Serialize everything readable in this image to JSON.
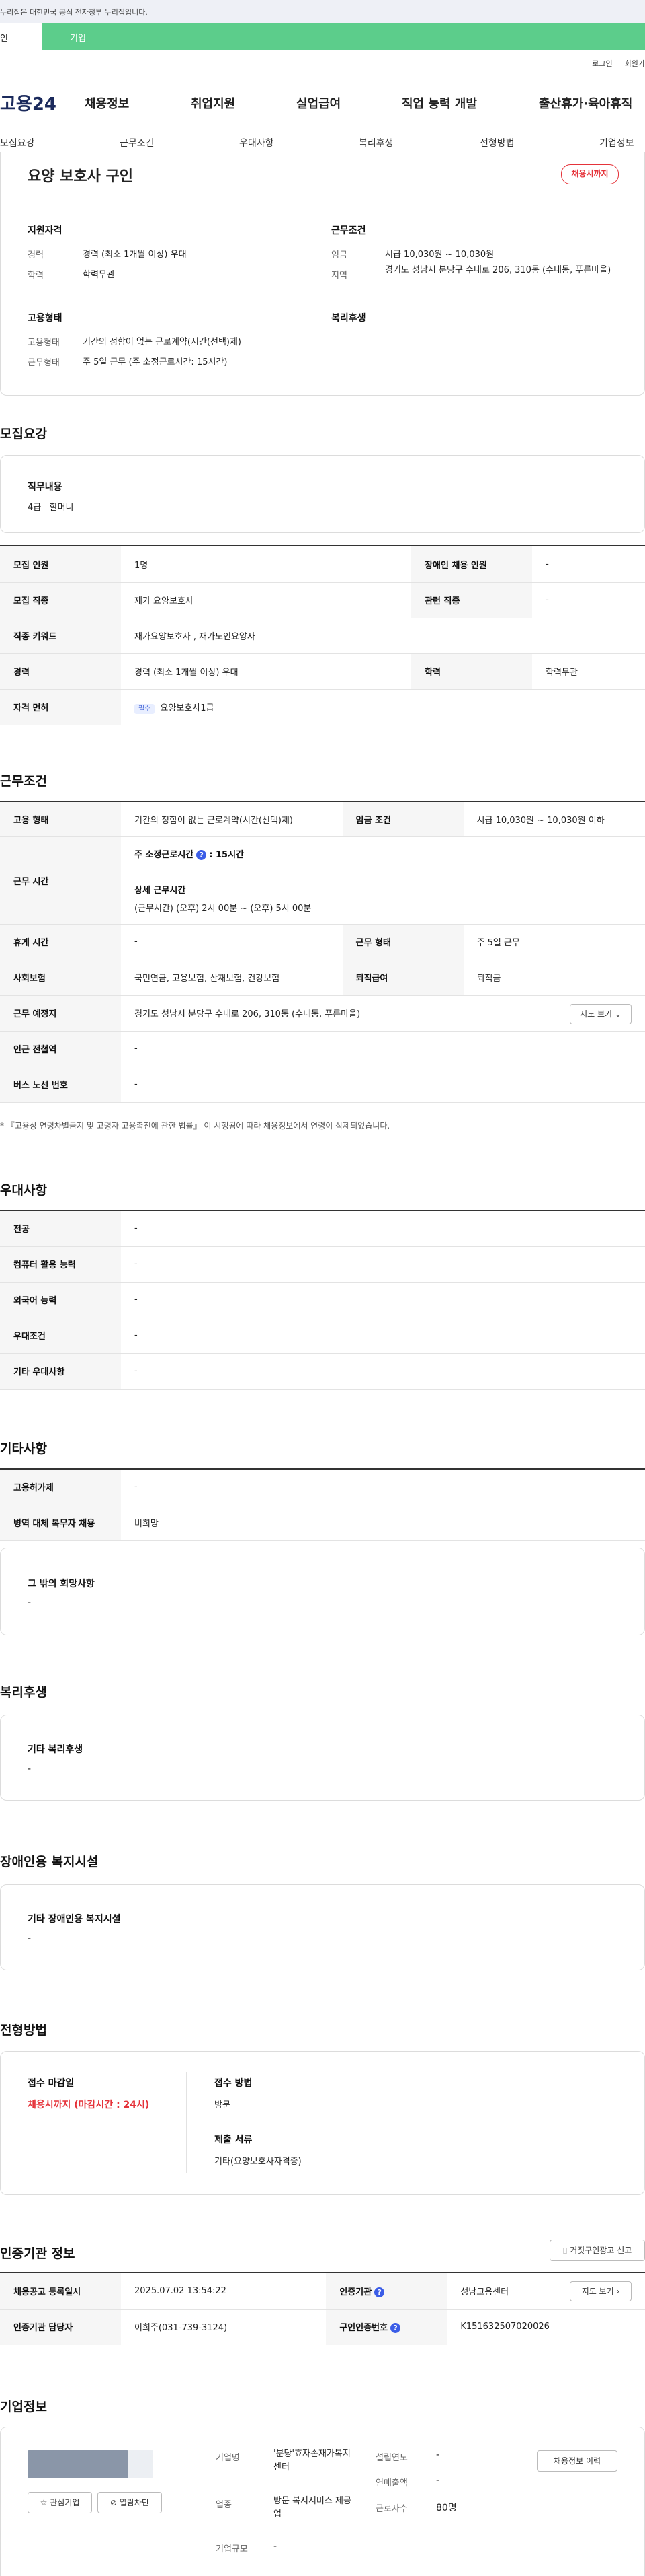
{
  "gov_banner": "누리집은 대한민국 공식 전자정부 누리집입니다.",
  "tabs": {
    "personal": "인",
    "company": "기업"
  },
  "util": {
    "login": "로그인",
    "join": "회원가"
  },
  "logo": "고용24",
  "gnb": [
    "채용정보",
    "취업지원",
    "실업급여",
    "직업 능력 개발",
    "출산휴가·육아휴직"
  ],
  "snb": [
    "모집요강",
    "근무조건",
    "우대사항",
    "복리후생",
    "전형방법",
    "기업정보"
  ],
  "summary": {
    "title": "요양 보호사 구인",
    "deadline_badge": "채용시까지",
    "qual_heading": "지원자격",
    "cond_heading": "근무조건",
    "emp_heading": "고용형태",
    "welfare_heading": "복리후생",
    "career_label": "경력",
    "career_value": "경력 (최소 1개월 이상) 우대",
    "edu_label": "학력",
    "edu_value": "학력무관",
    "wage_label": "임금",
    "wage_value": "시급 10,030원 ~ 10,030원",
    "region_label": "지역",
    "region_value": "경기도 성남시 분당구 수내로 206, 310동 (수내동, 푸른마을)",
    "emptype_label": "고용형태",
    "emptype_value": "기간의 정함이 없는 근로계약(시간(선택)제)",
    "worktype_label": "근무형태",
    "worktype_value": "주 5일 근무 (주 소정근로시간: 15시간)"
  },
  "recruit": {
    "section_title": "모집요강",
    "duty_label": "직무내용",
    "duty_value": "4급   할머니",
    "rows": {
      "count_label": "모집 인원",
      "count_value": "1명",
      "disabled_label": "장애인 채용 인원",
      "disabled_value": "-",
      "job_label": "모집 직종",
      "job_value": "재가 요양보호사",
      "related_label": "관련 직종",
      "related_value": "-",
      "keyword_label": "직종 키워드",
      "keyword_value": "재가요양보호사 , 재가노인요양사",
      "career_label": "경력",
      "career_value": "경력 (최소 1개월 이상) 우대",
      "edu_label": "학력",
      "edu_value": "학력무관",
      "license_label": "자격 면허",
      "license_tag": "필수",
      "license_value": "요양보호사1급"
    }
  },
  "conditions": {
    "section_title": "근무조건",
    "emptype_label": "고용 형태",
    "emptype_value": "기간의 정함이 없는 근로계약(시간(선택)제)",
    "wage_label": "임금 조건",
    "wage_value": "시급 10,030원 ~ 10,030원 이하",
    "hours_label": "근무 시간",
    "hours_weekly": "주 소정근로시간",
    "hours_weekly_value": "15시간",
    "hours_detail_title": "상세 근무시간",
    "hours_detail": "(근무시간) (오후) 2시 00분 ~ (오후) 5시 00분",
    "rest_label": "휴게 시간",
    "rest_value": "-",
    "worktype_label": "근무 형태",
    "worktype_value": "주 5일 근무",
    "insurance_label": "사회보험",
    "insurance_value": "국민연금, 고용보험, 산재보험, 건강보험",
    "severance_label": "퇴직급여",
    "severance_value": "퇴직금",
    "location_label": "근무 예정지",
    "location_value": "경기도 성남시 분당구 수내로 206, 310동 (수내동, 푸른마을)",
    "map_button": "지도 보기",
    "subway_label": "인근 전철역",
    "subway_value": "-",
    "bus_label": "버스 노선 번호",
    "bus_value": "-",
    "note": "* 『고용상 연령차별금지 및 고령자 고용촉진에 관한 법률』 이 시행됨에 따라 채용정보에서 연령이 삭제되었습니다."
  },
  "preference": {
    "section_title": "우대사항",
    "rows": [
      {
        "label": "전공",
        "value": "-"
      },
      {
        "label": "컴퓨터 활용 능력",
        "value": "-"
      },
      {
        "label": "외국어 능력",
        "value": "-"
      },
      {
        "label": "우대조건",
        "value": "-"
      },
      {
        "label": "기타 우대사항",
        "value": "-"
      }
    ]
  },
  "etc": {
    "section_title": "기타사항",
    "rows": [
      {
        "label": "고용허가제",
        "value": "-"
      },
      {
        "label": "병역 대체 복무자 채용",
        "value": "비희망"
      }
    ],
    "wish_title": "그 밖의 희망사항",
    "wish_value": "-"
  },
  "welfare": {
    "section_title": "복리후생",
    "box_title": "기타 복리후생",
    "box_value": "-"
  },
  "disabled_facility": {
    "section_title": "장애인용 복지시설",
    "box_title": "기타 장애인용 복지시설",
    "box_value": "-"
  },
  "selection": {
    "section_title": "전형방법",
    "deadline_title": "접수 마감일",
    "deadline_value": "채용시까지 (마감시간 : 24시)",
    "method_title": "접수 방법",
    "method_value": "방문",
    "docs_title": "제출 서류",
    "docs_value": "기타(요양보호사자격증)"
  },
  "agency": {
    "section_title": "인증기관 정보",
    "report_button": "거짓구인광고 신고",
    "reg_label": "채용공고 등록일시",
    "reg_value": "2025.07.02 13:54:22",
    "org_label": "인증기관",
    "org_value": "성남고용센터",
    "map_button": "지도 보기",
    "manager_label": "인증기관 담당자",
    "manager_value": "이희주(031-739-3124)",
    "no_label": "구인인증번호",
    "no_value": "K151632507020026"
  },
  "company": {
    "section_title": "기업정보",
    "name_label": "기업명",
    "name_value": "'분당'효자손재가복지센터",
    "industry_label": "업종",
    "industry_value": "방문 복지서비스 제공업",
    "size_label": "기업규모",
    "size_value": "-",
    "founded_label": "설립연도",
    "founded_value": "-",
    "sales_label": "연매출액",
    "sales_value": "-",
    "employees_label": "근로자수",
    "employees_value": "80명",
    "history_button": "채용정보 이력",
    "fav_button": "관심기업",
    "block_button": "열람차단",
    "star_icon": "star-icon",
    "block_icon": "block-icon"
  }
}
